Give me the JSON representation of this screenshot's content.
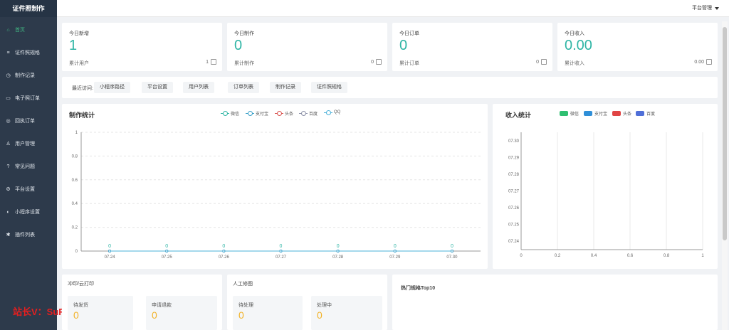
{
  "app": {
    "title": "证件照制作"
  },
  "watermark": "站长V：SuRen-WL",
  "topbar": {
    "platform_menu": "平台管理"
  },
  "sidebar": {
    "items": [
      {
        "label": "首页",
        "icon": "home-icon",
        "active": true
      },
      {
        "label": "证件照规格",
        "icon": "list-icon"
      },
      {
        "label": "制作记录",
        "icon": "clock-icon"
      },
      {
        "label": "电子照订单",
        "icon": "card-icon"
      },
      {
        "label": "回执订单",
        "icon": "receipt-icon"
      },
      {
        "label": "用户管理",
        "icon": "user-icon"
      },
      {
        "label": "常见问题",
        "icon": "question-icon"
      },
      {
        "label": "平台设置",
        "icon": "gear-icon"
      },
      {
        "label": "小程序设置",
        "icon": "miniapp-icon"
      },
      {
        "label": "插件列表",
        "icon": "plugin-icon"
      }
    ]
  },
  "stats": [
    {
      "label": "今日新增",
      "value": "1",
      "foot_label": "累计用户",
      "foot_value": "1"
    },
    {
      "label": "今日制作",
      "value": "0",
      "foot_label": "累计制作",
      "foot_value": "0"
    },
    {
      "label": "今日订单",
      "value": "0",
      "foot_label": "累计订单",
      "foot_value": "0"
    },
    {
      "label": "今日收入",
      "value": "0.00",
      "foot_label": "累计收入",
      "foot_value": "0.00"
    }
  ],
  "recent": {
    "label": "最近访问:",
    "links": [
      "小程序路径",
      "平台设置",
      "用户列表",
      "订单列表",
      "制作记录",
      "证件照规格"
    ]
  },
  "colors": {
    "accent": "#2fb5a5",
    "sidebar": "#2d3a4b",
    "active": "#41b883",
    "warning": "#f2b32a"
  },
  "production_panel": {
    "title": "制作统计"
  },
  "income_panel": {
    "title": "收入统计"
  },
  "print_panel": {
    "title": "冲印/云打印",
    "boxes": [
      {
        "label": "待发货",
        "value": "0"
      },
      {
        "label": "申请退款",
        "value": "0"
      }
    ]
  },
  "retouch_panel": {
    "title": "人工修图",
    "boxes": [
      {
        "label": "待处理",
        "value": "0"
      },
      {
        "label": "处理中",
        "value": "0"
      }
    ]
  },
  "top_panel": {
    "title": "热门规格Top10"
  },
  "chart_data": [
    {
      "type": "line",
      "title": "制作统计",
      "categories": [
        "07.24",
        "07.25",
        "07.26",
        "07.27",
        "07.28",
        "07.29",
        "07.30"
      ],
      "series": [
        {
          "name": "微信",
          "values": [
            0,
            0,
            0,
            0,
            0,
            0,
            0
          ],
          "color": "#2fb5a5"
        },
        {
          "name": "支付宝",
          "values": [
            0,
            0,
            0,
            0,
            0,
            0,
            0
          ],
          "color": "#3aa0c8"
        },
        {
          "name": "头条",
          "values": [
            0,
            0,
            0,
            0,
            0,
            0,
            0
          ],
          "color": "#d9534f"
        },
        {
          "name": "百度",
          "values": [
            0,
            0,
            0,
            0,
            0,
            0,
            0
          ],
          "color": "#8a8fa6"
        },
        {
          "name": "QQ",
          "values": [
            0,
            0,
            0,
            0,
            0,
            0,
            0
          ],
          "color": "#4ab0d9"
        }
      ],
      "y_ticks": [
        "0",
        "0.2",
        "0.4",
        "0.6",
        "0.8",
        "1"
      ],
      "ylim": [
        0,
        1
      ],
      "point_labels": [
        "0",
        "0",
        "0",
        "0",
        "0",
        "0",
        "0"
      ],
      "grid": true,
      "legend": "top"
    },
    {
      "type": "bar",
      "title": "收入统计",
      "orientation": "horizontal",
      "series": [
        {
          "name": "微信",
          "color": "#2fbf71"
        },
        {
          "name": "支付宝",
          "color": "#2f8fd8"
        },
        {
          "name": "头条",
          "color": "#e04545"
        },
        {
          "name": "百度",
          "color": "#4f6fd8"
        }
      ],
      "y_ticks": [
        "07.24",
        "07.25",
        "07.26",
        "07.27",
        "07.28",
        "07.29",
        "07.30"
      ],
      "x_ticks": [
        "0",
        "0.2",
        "0.4",
        "0.6",
        "0.8",
        "1"
      ],
      "xlim": [
        0,
        1
      ],
      "grid": true,
      "legend": "top"
    }
  ]
}
